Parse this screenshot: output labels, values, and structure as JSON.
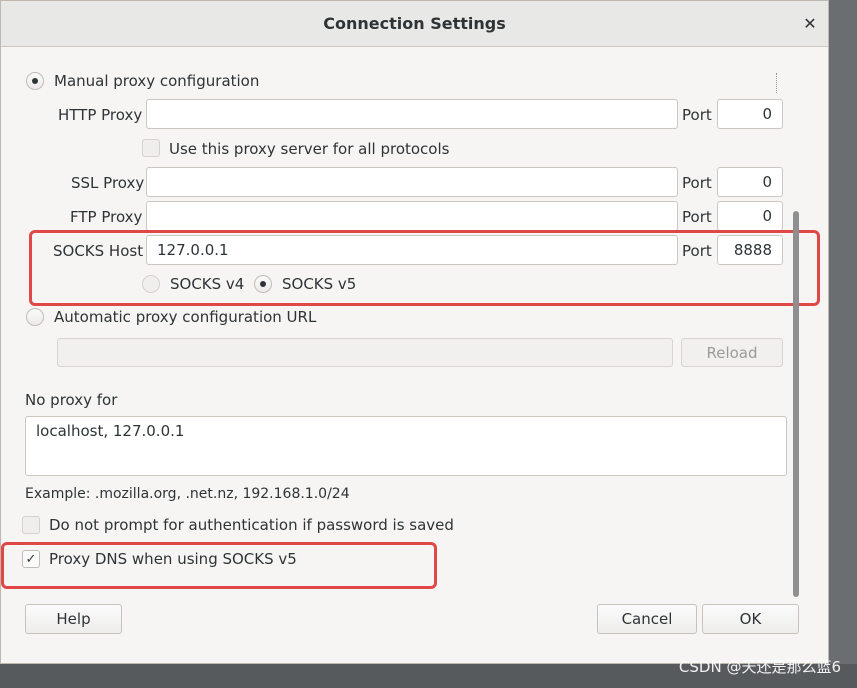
{
  "window": {
    "title": "Connection Settings"
  },
  "proxy": {
    "manual_label": "Manual proxy configuration",
    "http": {
      "label": "HTTP Proxy",
      "value": "",
      "port_label": "Port",
      "port": "0"
    },
    "use_all_label": "Use this proxy server for all protocols",
    "ssl": {
      "label": "SSL Proxy",
      "value": "",
      "port_label": "Port",
      "port": "0"
    },
    "ftp": {
      "label": "FTP Proxy",
      "value": "",
      "port_label": "Port",
      "port": "0"
    },
    "socks": {
      "label": "SOCKS Host",
      "value": "127.0.0.1",
      "port_label": "Port",
      "port": "8888"
    },
    "socks_v4_label": "SOCKS v4",
    "socks_v5_label": "SOCKS v5",
    "auto_url_label": "Automatic proxy configuration URL",
    "auto_url_value": "",
    "reload_label": "Reload"
  },
  "no_proxy": {
    "label": "No proxy for",
    "value": "localhost, 127.0.0.1",
    "example": "Example: .mozilla.org, .net.nz, 192.168.1.0/24"
  },
  "options": {
    "no_auth_prompt_label": "Do not prompt for authentication if password is saved",
    "proxy_dns_label": "Proxy DNS when using SOCKS v5"
  },
  "buttons": {
    "help": "Help",
    "cancel": "Cancel",
    "ok": "OK"
  },
  "watermark": "CSDN @天还是那么蓝6",
  "colors": {
    "highlight": "#e04848",
    "background": "#f6f5f4"
  }
}
